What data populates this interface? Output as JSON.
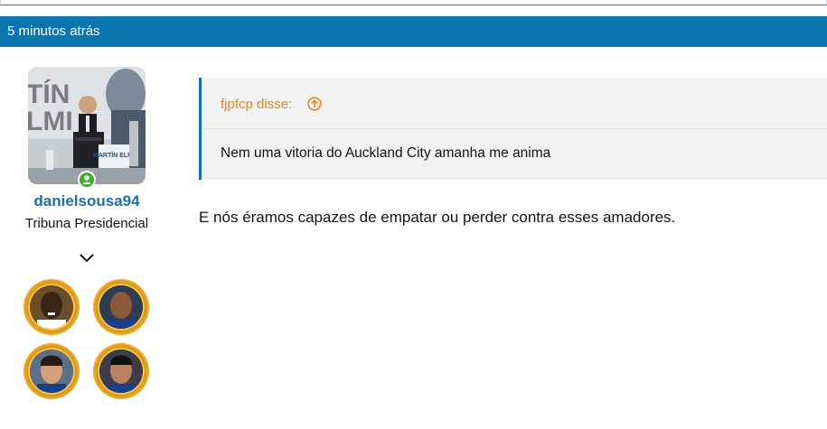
{
  "post": {
    "timestamp": "5 minutos atrás"
  },
  "user": {
    "name": "danielsousa94",
    "title": "Tribuna Presidencial",
    "online": true,
    "avatar_text": "MARTÍN ELMI"
  },
  "quote": {
    "author_label": "fjpfcp disse:",
    "text": "Nem uma vitoria do Auckland City amanha me anima"
  },
  "message": {
    "text": "E nós éramos capazes de empatar ou perder contra esses amadores."
  },
  "icons": {
    "jump": "circle-arrow-up-icon",
    "online": "online-user-icon",
    "toggle": "chevron-down-icon"
  },
  "colors": {
    "header_bg": "#0b75ad",
    "username": "#1f6fa3",
    "quote_author": "#e58a1c",
    "online": "#3fae2a"
  }
}
